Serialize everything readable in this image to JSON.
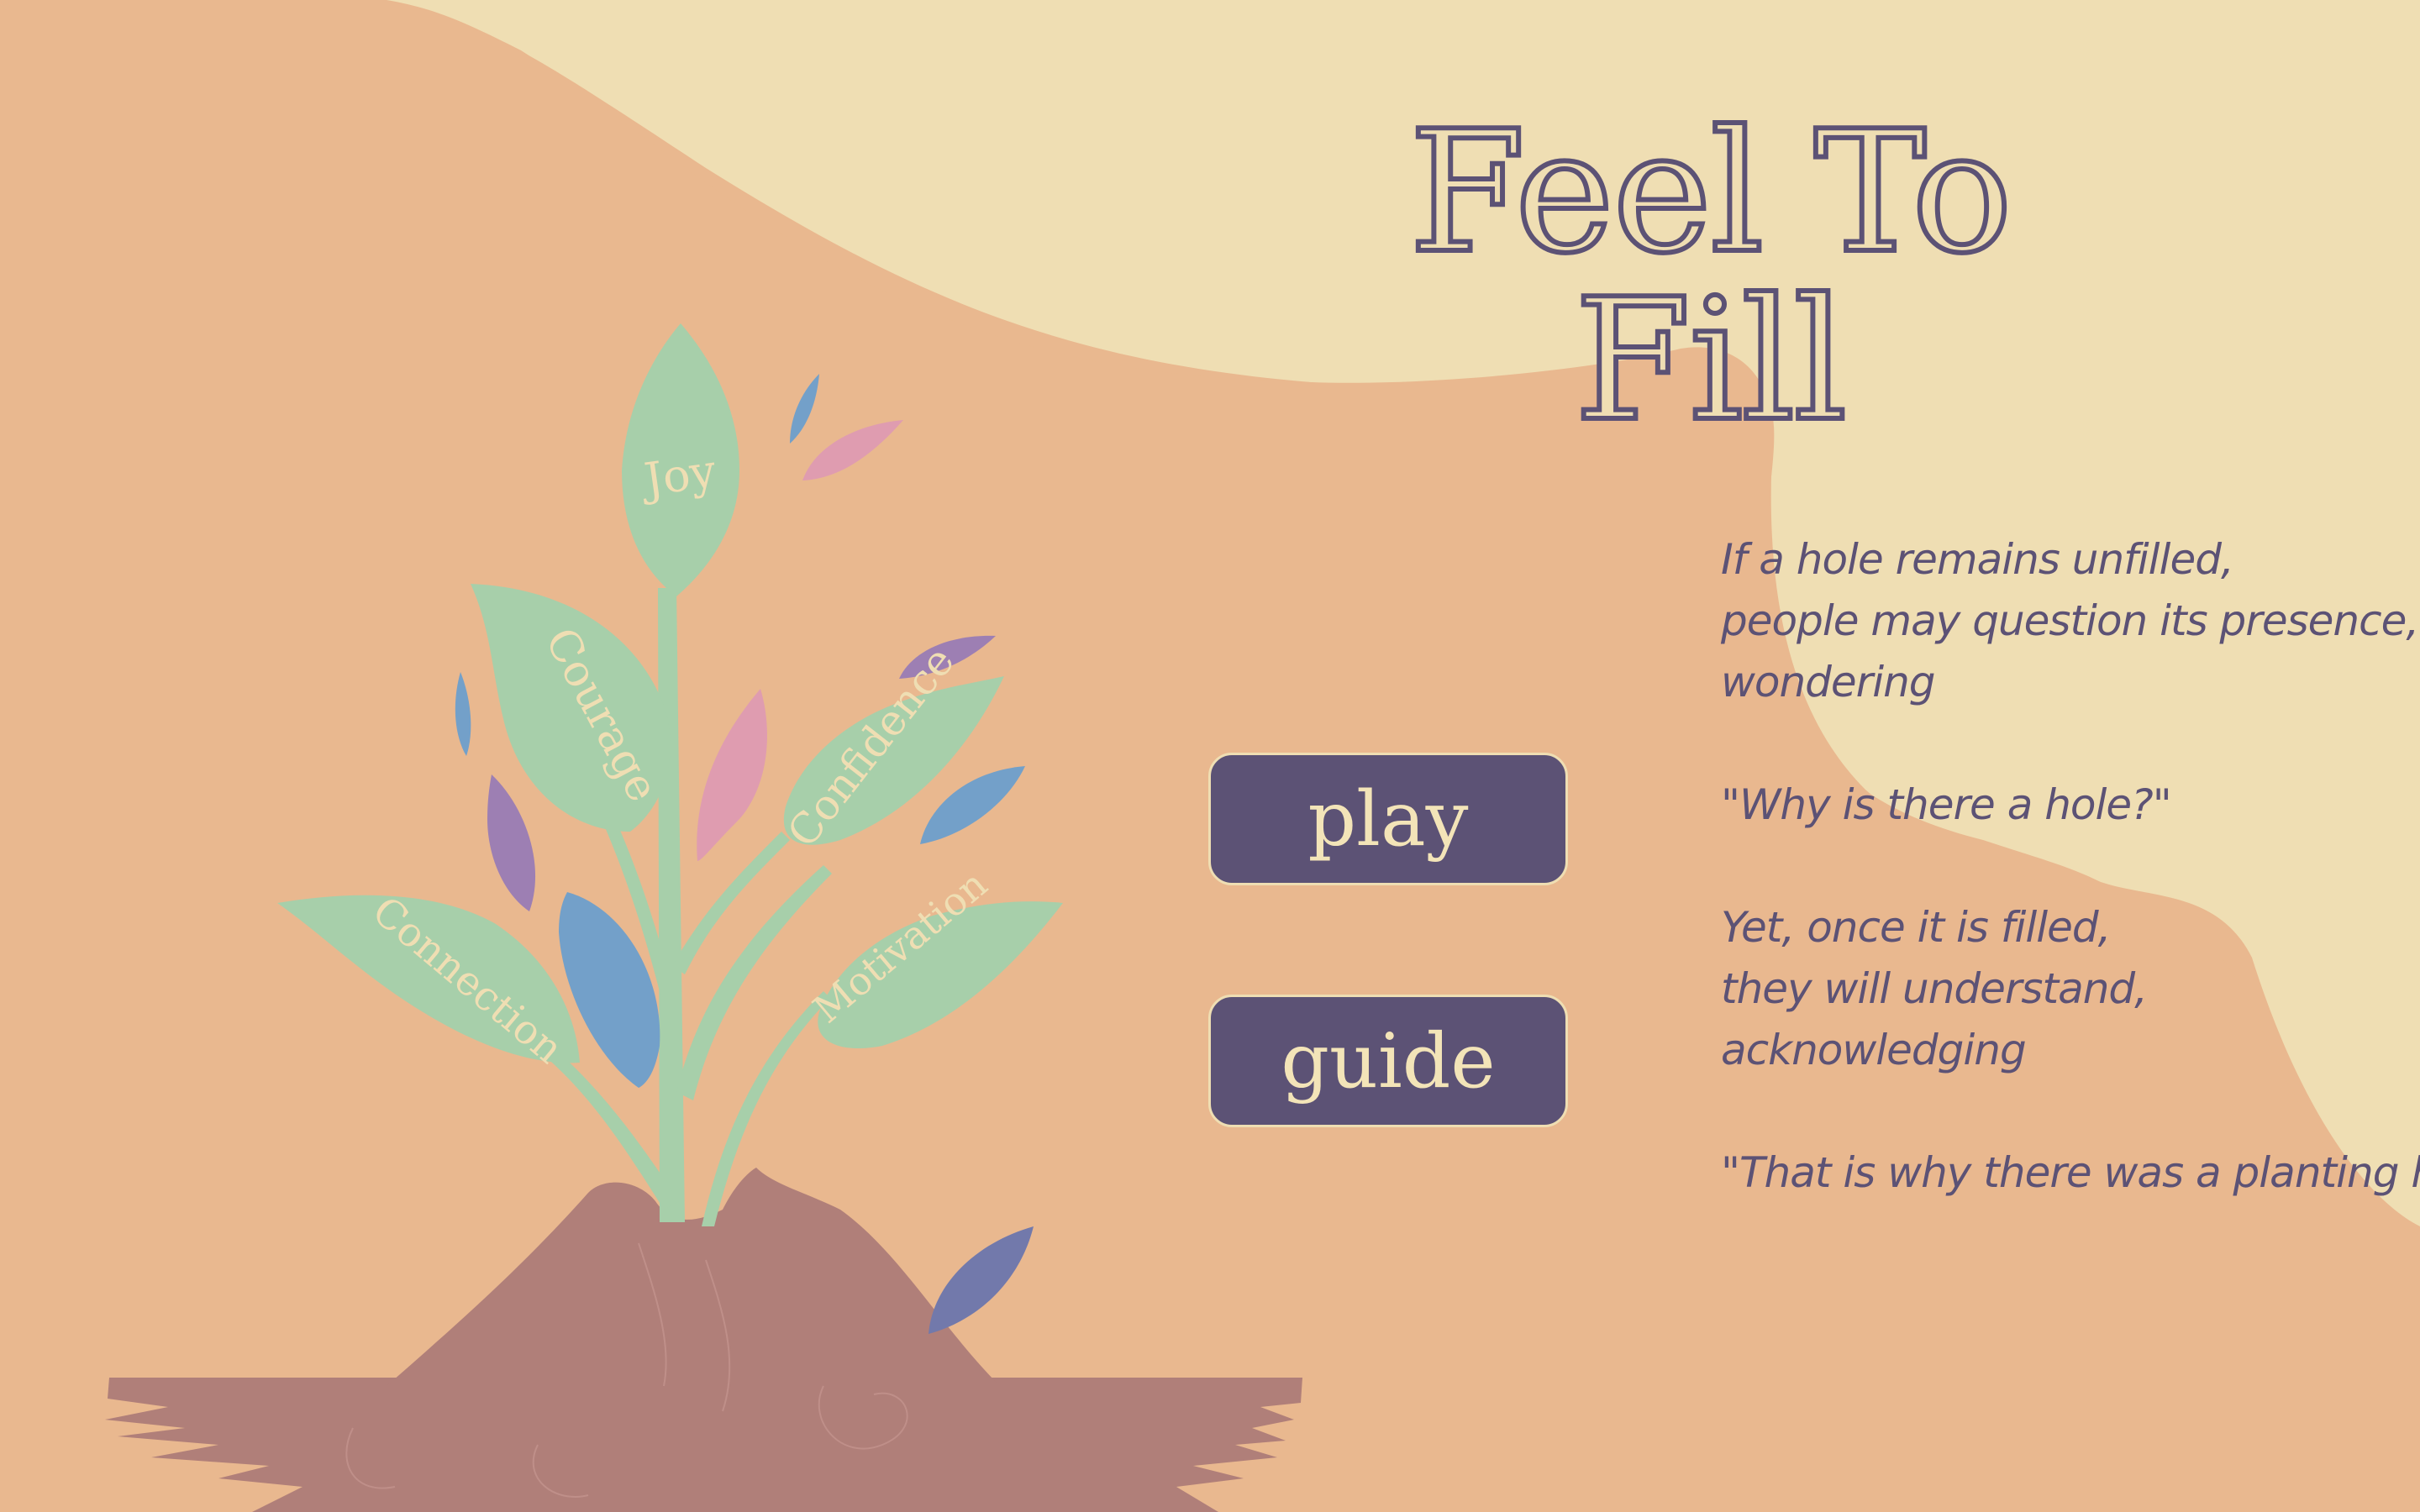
{
  "game": {
    "title": "Feel To Fill",
    "buttons": {
      "play": "play",
      "guide": "guide"
    },
    "poem": [
      "If a hole remains unfilled,",
      "people may question its presence,",
      "wondering",
      "",
      "\"Why is there a hole?\"",
      "",
      "Yet, once it is filled,",
      "they will understand,",
      "acknowledging",
      "",
      "\"That is why there was a planting hole\""
    ],
    "leaves": {
      "joy": "Joy",
      "courage": "Courage",
      "confidence": "Confidence",
      "connection": "Connection",
      "motivation": "Motivation"
    }
  },
  "colors": {
    "background": "#e9b88f",
    "cream": "#efdeb3",
    "ink": "#5c5275",
    "leaf_green": "#a7cfaa",
    "soil": "#b07f79",
    "pink": "#df9cb0",
    "blue": "#73a0c9",
    "purple": "#9d7fb3",
    "indigo": "#7279ab"
  }
}
